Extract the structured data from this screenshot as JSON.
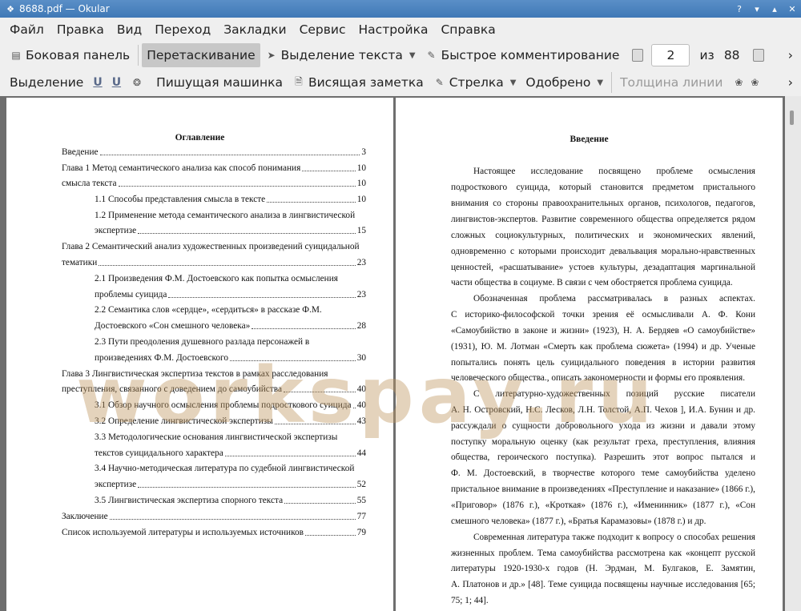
{
  "window": {
    "title": "8688.pdf  — Okular",
    "buttons": {
      "help": "?",
      "minimize": "▾",
      "maximize": "▴",
      "close": "✕"
    }
  },
  "menu": [
    "Файл",
    "Правка",
    "Вид",
    "Переход",
    "Закладки",
    "Сервис",
    "Настройка",
    "Справка"
  ],
  "toolbar1": {
    "sidebar": "Боковая панель",
    "drag": "Перетаскивание",
    "text_select": "Выделение текста",
    "quick_comment": "Быстрое комментирование",
    "page_current": "2",
    "page_of": "из",
    "page_total": "88",
    "overflow": "›"
  },
  "toolbar2": {
    "selection": "Выделение",
    "u1": "U",
    "u2": "U",
    "typewriter": "Пишущая машинка",
    "hanging_note": "Висящая заметка",
    "arrow": "Стрелка",
    "approved": "Одобрено",
    "line_width": "Толщина линии",
    "overflow": "›"
  },
  "watermark": "workspay.ru",
  "page1": {
    "title": "Оглавление",
    "entries": [
      {
        "text": "Введение",
        "page": "3"
      },
      {
        "text": "Глава 1 Метод семантического анализа как способ понимания",
        "page": "10"
      },
      {
        "text": "смысла текста",
        "page": "10"
      },
      {
        "text": "1.1 Способы представления смысла в тексте",
        "page": "10"
      },
      {
        "text": "1.2 Применение метода семантического анализа в лингвистической"
      },
      {
        "text": "экспертизе",
        "page": "15"
      },
      {
        "text": "Глава 2 Семантический анализ художественных произведений суицидальной"
      },
      {
        "text": "тематики",
        "page": "23"
      },
      {
        "text": "2.1 Произведения Ф.М. Достоевского как попытка осмысления"
      },
      {
        "text": "проблемы суицида",
        "page": "23"
      },
      {
        "text": "2.2 Семантика слов «сердце», «сердиться» в рассказе Ф.М."
      },
      {
        "text": "Достоевского «Сон смешного человека»",
        "page": "28"
      },
      {
        "text": "2.3 Пути преодоления душевного разлада персонажей в"
      },
      {
        "text": "произведениях Ф.М. Достоевского",
        "page": "30"
      },
      {
        "text": "Глава 3 Лингвистическая экспертиза текстов в рамках расследования"
      },
      {
        "text": "преступления, связанного с доведением до самоубийства",
        "page": "40"
      },
      {
        "text": "3.1 Обзор научного осмысления проблемы подросткового суицида",
        "page": "40"
      },
      {
        "text": "3.2 Определение лингвистической экспертизы",
        "page": "43"
      },
      {
        "text": "3.3 Методологические основания лингвистической экспертизы"
      },
      {
        "text": "текстов суицидального характера",
        "page": "44"
      },
      {
        "text": "3.4 Научно-методическая литература по судебной лингвистической"
      },
      {
        "text": "экспертизе",
        "page": "52"
      },
      {
        "text": "3.5 Лингвистическая экспертиза спорного текста",
        "page": "55"
      },
      {
        "text": "Заключение",
        "page": "77"
      },
      {
        "text": "Список используемой литературы и используемых источников",
        "page": "79"
      }
    ]
  },
  "page2": {
    "title": "Введение",
    "lines": [
      "Настоящее исследование посвящено проблеме осмысления",
      "подросткового суицида, который становится предметом пристального",
      "внимания со стороны правоохранительных органов, психологов, педагогов,",
      "лингвистов-экспертов. Развитие современного общества определяется рядом",
      "сложных социокультурных, политических и экономических явлений,",
      "одновременно с которыми происходит девальвация морально-нравственных",
      "ценностей, «расшатывание» устоев культуры, дезадаптация маргинальной",
      "части общества в социуме. В связи с чем обостряется проблема суицида.",
      "Обозначенная проблема рассматривалась в разных аспектах.",
      "С историко-философской точки зрения её осмысливали А. Ф. Кони",
      "«Самоубийство в законе и жизни» (1923), Н. А. Бердяев «О самоубийстве»",
      "(1931), Ю. М. Лотман «Смерть как проблема сюжета» (1994) и др. Ученые",
      "попытались понять цель суицидального поведения в истории развития",
      "человеческого общества., описать закономерности и формы его проявления.",
      "С литературно-художественных позиций русские писатели",
      "А. Н. Островский, Н.С. Лесков, Л.Н. Толстой, А.П. Чехов ], И.А. Бунин и др.",
      "рассуждали о сущности добровольного ухода из жизни и давали этому",
      "поступку моральную оценку (как результат греха, преступления, влияния",
      "общества, героического поступка). Разрешить этот вопрос пытался и",
      "Ф. М. Достоевский, в творчестве которого теме самоубийства уделено",
      "пристальное внимание в произведениях «Преступление и наказание» (1866 г.),",
      "«Приговор» (1876 г.), «Кроткая» (1876 г.), «Именинник» (1877 г.), «Сон",
      "смешного человека» (1877 г.), «Братья Карамазовы» (1878 г.) и др.",
      "Современная литература также подходит к вопросу о способах решения",
      "жизненных проблем. Тема самоубийства рассмотрена как «концепт русской",
      "литературы 1920-1930-х годов (Н. Эрдман, М. Булгаков, Е. Замятин,",
      "А. Платонов и др.» [48]. Теме суицида посвящены научные исследования [65;",
      "75; 1; 44]."
    ]
  }
}
